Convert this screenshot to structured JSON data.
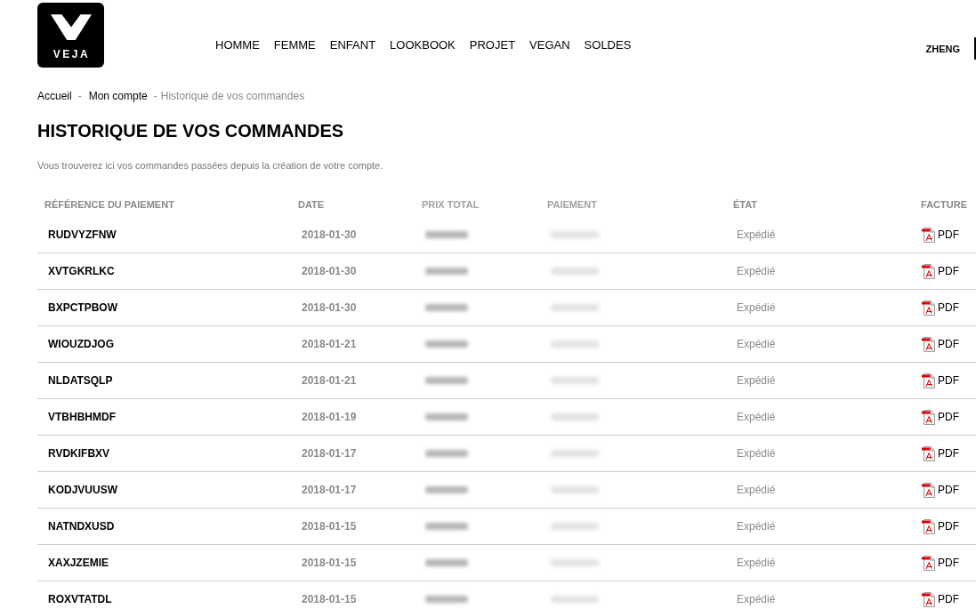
{
  "header": {
    "logo_text": "VEJA",
    "nav": [
      "HOMME",
      "FEMME",
      "ENFANT",
      "LOOKBOOK",
      "PROJET",
      "VEGAN",
      "SOLDES"
    ],
    "user": "ZHENG"
  },
  "breadcrumb": {
    "items": [
      {
        "label": "Accueil",
        "current": false
      },
      {
        "separator": "-",
        "label": "Mon compte",
        "current": false
      },
      {
        "separator": "-",
        "label": "Historique de vos commandes",
        "current": true
      }
    ]
  },
  "page": {
    "title": "HISTORIQUE DE VOS COMMANDES",
    "intro": "Vous trouverez ici vos commandes passées depuis la création de votre compte."
  },
  "orders_table": {
    "columns": [
      {
        "label": "RÉFÉRENCE DU PAIEMENT",
        "kind": "reference"
      },
      {
        "label": "DATE",
        "kind": "date"
      },
      {
        "label": "PRIX TOTAL",
        "kind": "blurred"
      },
      {
        "label": "PAIEMENT",
        "kind": "blurred"
      },
      {
        "label": "ÉTAT",
        "kind": "status"
      },
      {
        "label": "FACTURE",
        "kind": "invoice"
      }
    ],
    "rows": [
      {
        "reference": "RUDVYZFNW",
        "date": "2018-01-30",
        "status": "Expédié",
        "invoice": "PDF"
      },
      {
        "reference": "XVTGKRLKC",
        "date": "2018-01-30",
        "status": "Expédié",
        "invoice": "PDF"
      },
      {
        "reference": "BXPCTPBOW",
        "date": "2018-01-30",
        "status": "Expédié",
        "invoice": "PDF"
      },
      {
        "reference": "WIOUZDJOG",
        "date": "2018-01-21",
        "status": "Expédié",
        "invoice": "PDF"
      },
      {
        "reference": "NLDATSQLP",
        "date": "2018-01-21",
        "status": "Expédié",
        "invoice": "PDF"
      },
      {
        "reference": "VTBHBHMDF",
        "date": "2018-01-19",
        "status": "Expédié",
        "invoice": "PDF"
      },
      {
        "reference": "RVDKIFBXV",
        "date": "2018-01-17",
        "status": "Expédié",
        "invoice": "PDF"
      },
      {
        "reference": "KODJVUUSW",
        "date": "2018-01-17",
        "status": "Expédié",
        "invoice": "PDF"
      },
      {
        "reference": "NATNDXUSD",
        "date": "2018-01-15",
        "status": "Expédié",
        "invoice": "PDF"
      },
      {
        "reference": "XAXJZEMIE",
        "date": "2018-01-15",
        "status": "Expédié",
        "invoice": "PDF"
      },
      {
        "reference": "ROXVTATDL",
        "date": "2018-01-15",
        "status": "Expédié",
        "invoice": "PDF"
      }
    ]
  }
}
